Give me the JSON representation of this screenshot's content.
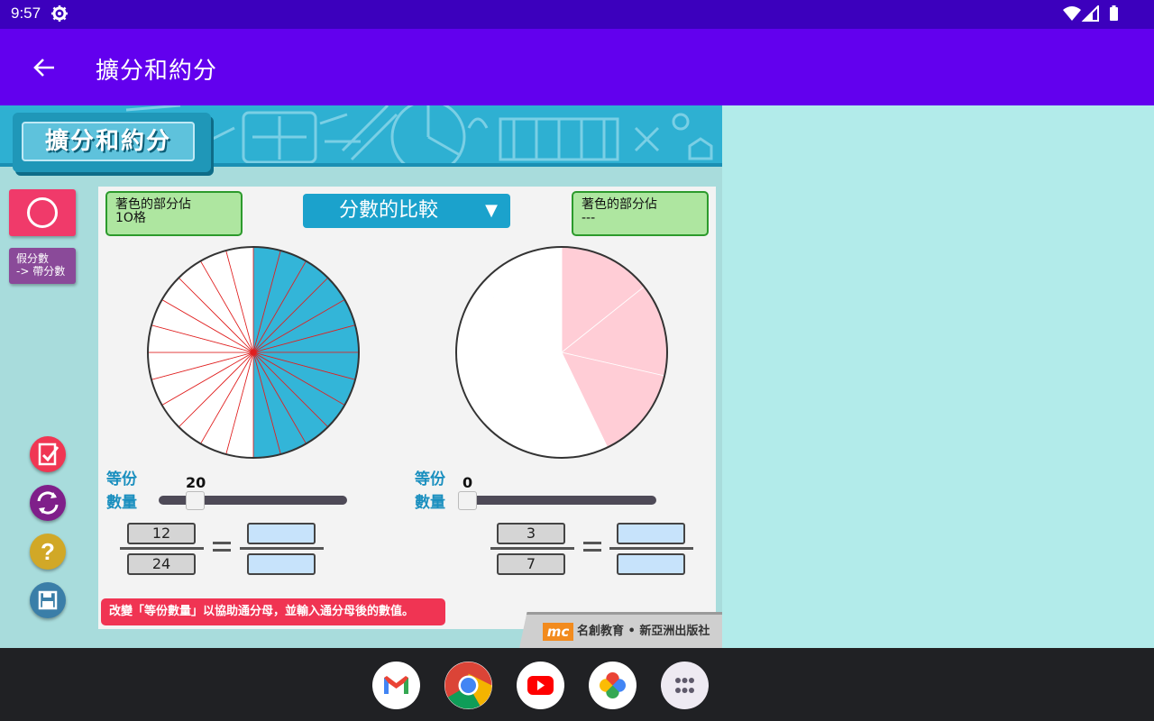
{
  "status_bar": {
    "time": "9:57"
  },
  "app_bar": {
    "title": "擴分和約分"
  },
  "banner": {
    "logo_text": "擴分和約分"
  },
  "sidebar": {
    "mixed_label_line1": "假分數",
    "mixed_label_line2": "-> 帶分數"
  },
  "panel": {
    "dropdown_label": "分數的比較",
    "left": {
      "info_line1": "著色的部分佔",
      "info_line2": "1O格",
      "equal_parts_label_1": "等份",
      "equal_parts_label_2": "數量",
      "slider_value": "20",
      "slider_fraction": 0.0,
      "numerator": "12",
      "denominator": "24",
      "pie_parts": 24,
      "pie_shaded": 12
    },
    "right": {
      "info_line1": "著色的部分佔",
      "info_line2": "---",
      "equal_parts_label_1": "等份",
      "equal_parts_label_2": "數量",
      "slider_value": "0",
      "slider_fraction": 0.0,
      "numerator": "3",
      "denominator": "7",
      "pie_parts": 7,
      "pie_shaded": 3
    },
    "hint": "改變「等份數量」以協助通分母，並輸入通分母後的數值。"
  },
  "publisher": {
    "logo": "mc",
    "text": "名創教育 • 新亞洲出版社"
  },
  "dock": {
    "apps": [
      "gmail-icon",
      "chrome-icon",
      "youtube-icon",
      "photos-icon",
      "app-drawer-icon"
    ]
  },
  "colors": {
    "accent": "#6200ee",
    "shaded_left": "#33b5d8",
    "shaded_right": "#ffcdd6"
  }
}
